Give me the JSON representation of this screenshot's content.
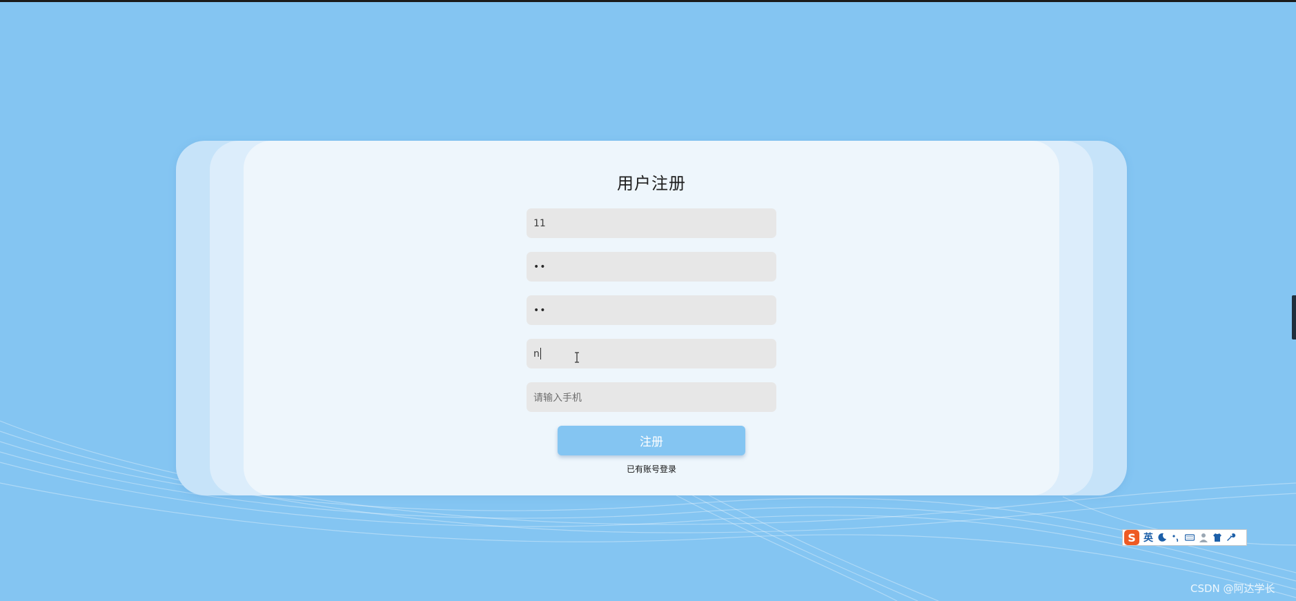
{
  "page": {
    "background_color": "#84c5f2",
    "card_colors": [
      "#c6e3f9",
      "#dcedfb",
      "#eef6fc"
    ]
  },
  "form": {
    "title": "用户注册",
    "username_value": "11",
    "password_value": "••",
    "confirm_password_value": "••",
    "fourth_field_value": "n",
    "phone_placeholder": "请输入手机",
    "submit_label": "注册",
    "login_link_label": "已有账号登录"
  },
  "ime_toolbar": {
    "logo": "S",
    "mode_label": "英",
    "icons": [
      "moon-icon",
      "punctuation-icon",
      "keyboard-icon",
      "user-icon",
      "shirt-icon",
      "wrench-icon"
    ]
  },
  "watermark": "CSDN @阿达学长"
}
